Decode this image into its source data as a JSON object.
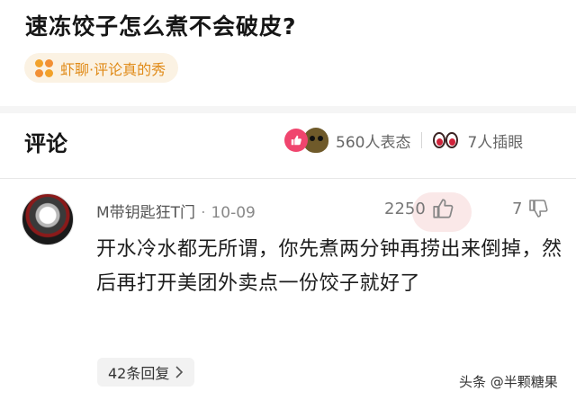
{
  "question": {
    "title": "速冻饺子怎么煮不会破皮?"
  },
  "source": {
    "label": "虾聊·评论真的秀",
    "icon": "four-dots-icon",
    "accent": "#f2a22b"
  },
  "comments_header": {
    "title": "评论",
    "reactions_count": "560人表态",
    "insert_eye_count": "7人插眼",
    "like_color": "#f0456e"
  },
  "comment": {
    "username": "M带钥匙狂T门",
    "date": "10-09",
    "like_count": "2250",
    "dislike_count": "7",
    "body": "开水冷水都无所谓，你先煮两分钟再捞出来倒掉，然后再打开美团外卖点一份饺子就好了",
    "replies_label": "42条回复"
  },
  "watermark": {
    "text": "头条 @半颗糖果"
  }
}
